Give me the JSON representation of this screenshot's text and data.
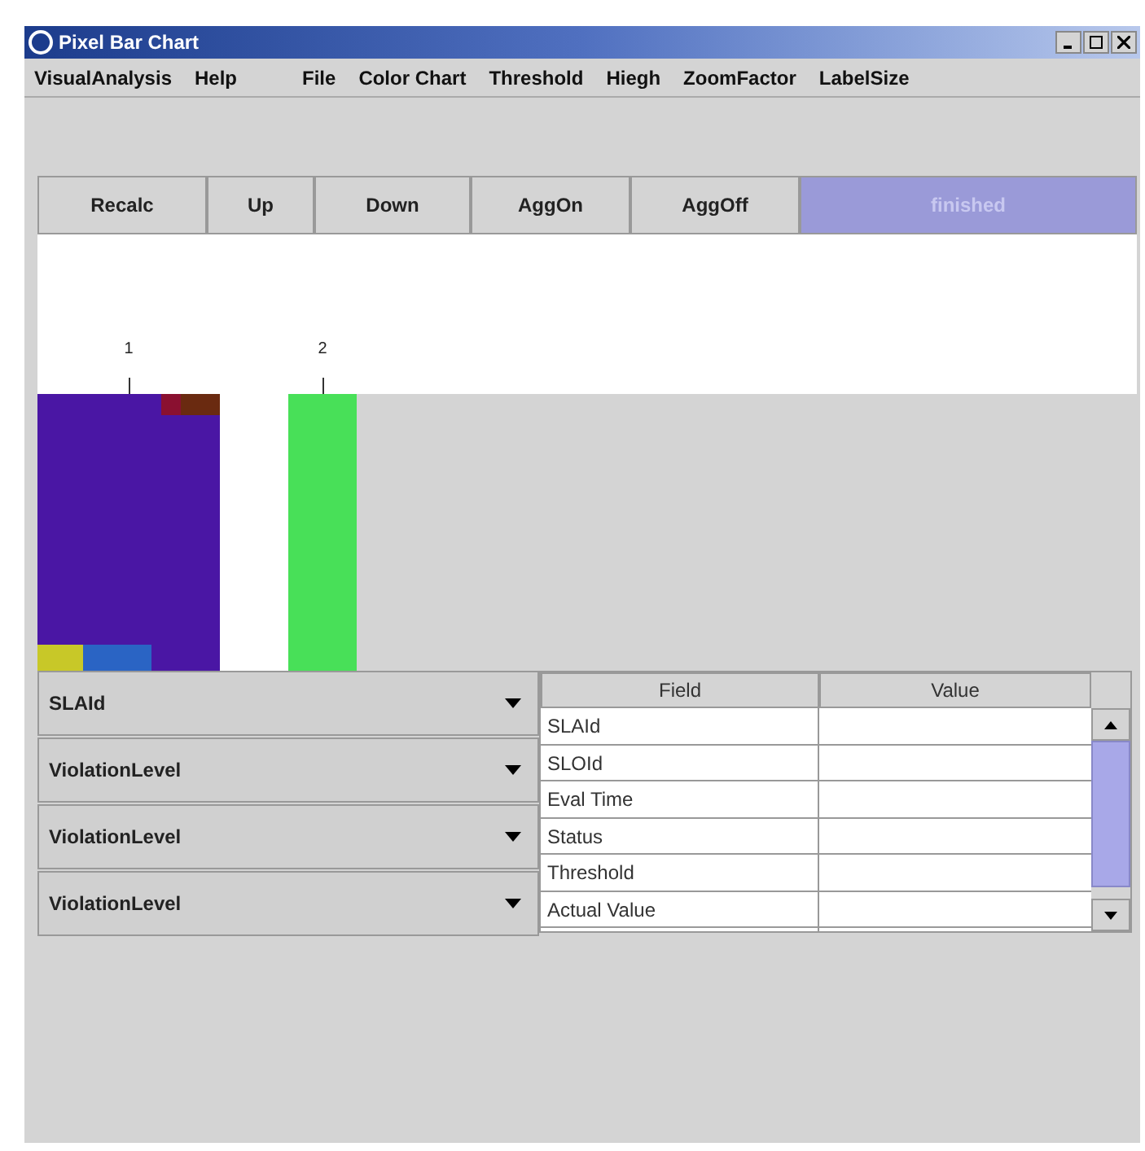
{
  "window": {
    "title": "Pixel Bar Chart"
  },
  "menu": [
    "VisualAnalysis",
    "Help",
    "File",
    "Color Chart",
    "Threshold",
    "Hiegh",
    "ZoomFactor",
    "LabelSize"
  ],
  "toolbar": [
    {
      "label": "Recalc",
      "disabled": false
    },
    {
      "label": "Up",
      "disabled": false
    },
    {
      "label": "Down",
      "disabled": false
    },
    {
      "label": "AggOn",
      "disabled": false
    },
    {
      "label": "AggOff",
      "disabled": false
    },
    {
      "label": "finished",
      "disabled": true
    }
  ],
  "bars": [
    {
      "label": "1"
    },
    {
      "label": "2"
    }
  ],
  "dropdowns": [
    {
      "value": "SLAId"
    },
    {
      "value": "ViolationLevel"
    },
    {
      "value": "ViolationLevel"
    },
    {
      "value": "ViolationLevel"
    }
  ],
  "table": {
    "columns": [
      "Field",
      "Value"
    ],
    "rows": [
      {
        "field": "SLAId"
      },
      {
        "field": "SLOId"
      },
      {
        "field": "Eval Time"
      },
      {
        "field": "Status"
      },
      {
        "field": "Threshold"
      },
      {
        "field": "Actual Value"
      }
    ]
  }
}
